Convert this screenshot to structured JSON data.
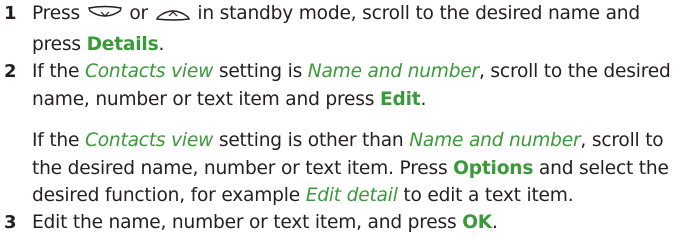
{
  "steps": [
    {
      "number": "1",
      "lines": [
        {
          "a": "Press ",
          "icon1": "scroll-down-key-icon",
          "b": " or ",
          "icon2": "scroll-up-key-icon",
          "c": " in standby mode, scroll to the desired name and"
        },
        {
          "a": "press ",
          "strong": "Details",
          "c": "."
        }
      ]
    },
    {
      "number": "2",
      "p1": [
        {
          "a": "If the ",
          "i1": "Contacts view",
          "b": " setting is ",
          "i2": "Name and number",
          "c": ", scroll to the desired"
        },
        {
          "a": "name, number or text item and press ",
          "strong": "Edit",
          "c": "."
        }
      ],
      "p2": [
        {
          "a": "If the ",
          "i1": "Contacts view",
          "b": " setting is other than ",
          "i2": "Name and number",
          "c": ", scroll to"
        },
        {
          "a": "the desired name, number or text item. Press ",
          "strong": "Options",
          "c": " and select the"
        },
        {
          "a": "desired function, for example ",
          "i1": "Edit detail",
          "c": " to edit a text item."
        }
      ]
    },
    {
      "number": "3",
      "lines": [
        {
          "a": "Edit the name, number or text item, and press ",
          "strong": "OK",
          "c": "."
        }
      ]
    }
  ]
}
